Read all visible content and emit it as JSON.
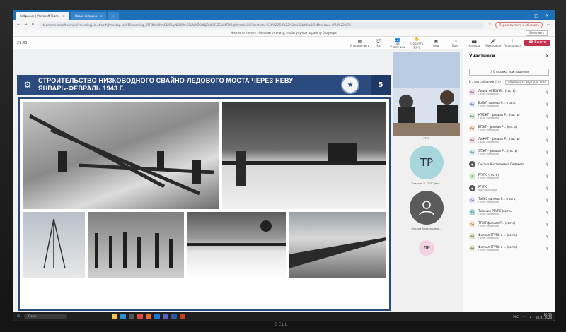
{
  "browser": {
    "tabs": [
      {
        "label": "Собрание | Microsoft Teams"
      },
      {
        "label": "Новая вкладка"
      }
    ],
    "url": "teams.microsoft.com/v2/?meetingjoin=true#/l/meetup-join/19:meeting_OTFlNmI3NmEtZGUyNi00MmE0LWJhZGItNjI3NGU3ZGUxMTY0@thread.v2/0?context=%7b%22Tid%22%3a%22bd85a3f2-4f0e-4aa4-8f7d%22%7d",
    "profile_label": "Перезапустить и обновить",
    "notice_text": "Нажмите кнопку «Обновить» внизу, чтобы улучшить работу браузера",
    "notice_button": "Включить"
  },
  "toolbar": {
    "time": "29:45",
    "tools": [
      {
        "label": "Упорядочить",
        "icon": "grid-icon"
      },
      {
        "label": "Чат",
        "icon": "chat-icon"
      },
      {
        "label": "Участники",
        "icon": "people-icon",
        "count": "68"
      },
      {
        "label": "Поднять руку",
        "icon": "hand-icon"
      },
      {
        "label": "Вид",
        "icon": "view-icon"
      },
      {
        "label": "Еще",
        "icon": "more-icon"
      },
      {
        "label": "Камера",
        "icon": "camera-icon"
      },
      {
        "label": "Микрофон",
        "icon": "mic-icon"
      },
      {
        "label": "Поделиться",
        "icon": "share-icon"
      }
    ],
    "leave_label": "Выйти"
  },
  "slide": {
    "title_line1": "СТРОИТЕЛЬСТВО НИЗКОВОДНОГО СВАЙНО-ЛЕДОВОГО МОСТА ЧЕРЕЗ НЕВУ",
    "title_line2": "ЯНВАРЬ-ФЕВРАЛЬ 1943 Г.",
    "page_number": "5",
    "presenter_badge": "РГУПС"
  },
  "videos": {
    "tile1_caption": "ЕГУ5",
    "tile2_initials": "ТР",
    "tile2_name": "Тимохин Р. ГУПС (все...",
    "tile3_name": "Оксана Анатольевна...",
    "tile4_initials": "ЛР",
    "colors": {
      "tile2": "#a7d7dc",
      "tile3": "#5b5b5b",
      "tile4": "#f3d1e1"
    }
  },
  "participants": {
    "title": "Участники",
    "invite_label": "Отправка приглашения",
    "section_label": "В этом собрании (14)",
    "mute_all_label": "Отключить звук для всех",
    "list": [
      {
        "initials": "ЛФ",
        "name": "Лицей ФГБОУ В... (гость)",
        "role": "Гость собрания",
        "color": "#ead1e6"
      },
      {
        "initials": "ВФ",
        "name": "ВзГИП филиал Р... (гость)",
        "role": "Гость собрания",
        "color": "#d9e3f5"
      },
      {
        "initials": "КФ",
        "name": "КТИЖТ - филиал Р... (гость)",
        "role": "Гость собрания",
        "color": "#d6ecd9"
      },
      {
        "initials": "ЕФ",
        "name": "ЕТЖТ - филиал Р... (гость)",
        "role": "Гость собрания",
        "color": "#f3dfc8"
      },
      {
        "initials": "ЛФ",
        "name": "ЛиЖАТ - филиал Р... (гость)",
        "role": "Гость собрания",
        "color": "#f0d5d8"
      },
      {
        "initials": "ЭФ",
        "name": "ЭТЖТ - филиал Р... (гость)",
        "role": "Гость собрания",
        "color": "#d4e8ee"
      },
      {
        "initials": "",
        "name": "Оксана Анатольевна Седякова",
        "role": "",
        "color": "#5b5b5b"
      },
      {
        "initials": "Р",
        "name": "РГУПС (гость)",
        "role": "Гость собрания",
        "color": "#d3e6cf"
      },
      {
        "initials": "",
        "name": "РГУПС",
        "role": "Выступающий",
        "color": "#5b5b5b"
      },
      {
        "initials": "ТФ",
        "name": "ТаГИС филиал Р... (гость)",
        "role": "Гость собрания",
        "color": "#e5d9f2"
      },
      {
        "initials": "ТР",
        "name": "Тимохин РГУПС (гость)",
        "role": "Гость собрания",
        "color": "#a7d7dc"
      },
      {
        "initials": "ТФ",
        "name": "ТТЖТ филиал Р... (гость)",
        "role": "Гость собрания",
        "color": "#f5e2c4"
      },
      {
        "initials": "ФР",
        "name": "Филиал РГУПС в ... (гость)",
        "role": "Гость собрания",
        "color": "#dde6c9"
      },
      {
        "initials": "ФР",
        "name": "Филиал РГУПС в ... (гость)",
        "role": "Гость собрания",
        "color": "#dde6c9"
      }
    ]
  },
  "taskbar": {
    "search_placeholder": "Поиск",
    "apps": [
      "file-explorer-icon",
      "edge-icon",
      "store-icon",
      "chrome-icon",
      "office-icon",
      "mail-icon",
      "teams-icon",
      "word-icon",
      "powerpoint-icon"
    ],
    "lang": "РУС",
    "time": "10:53",
    "date": "20.01.2024"
  }
}
